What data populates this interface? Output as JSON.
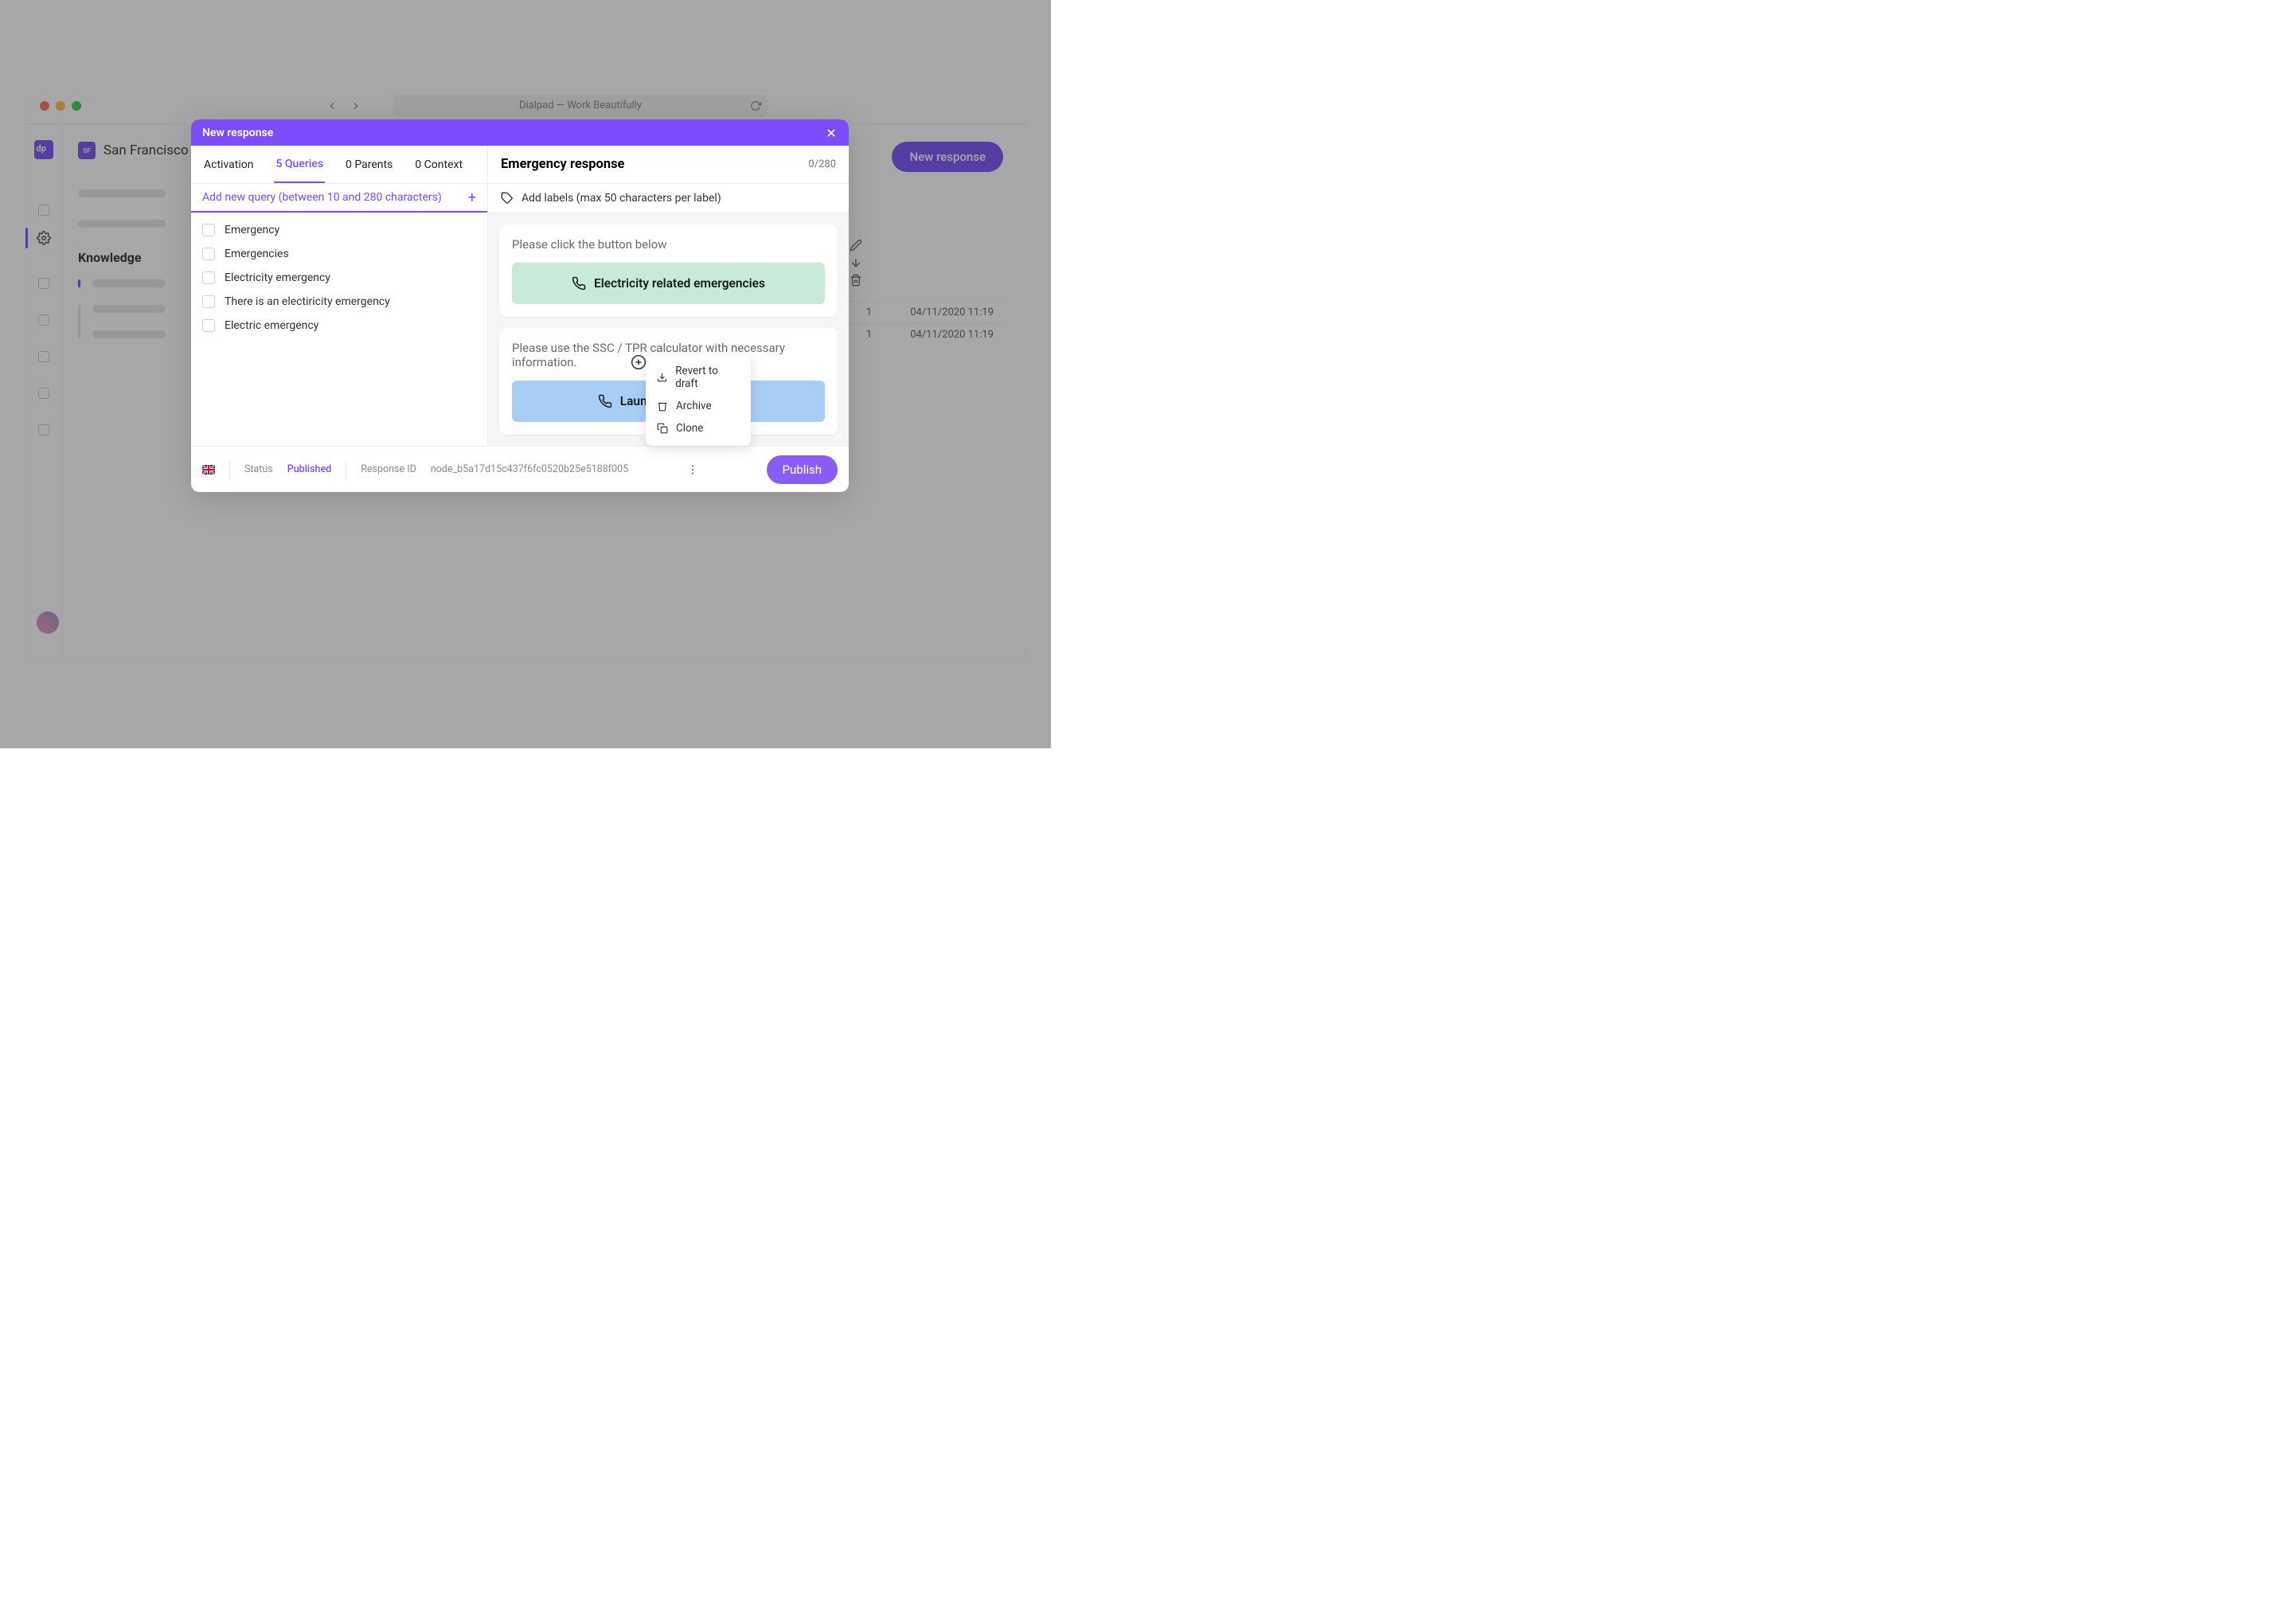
{
  "window": {
    "title": "Dialpad — Work Beautifully"
  },
  "sidebar": {
    "location_badge": "SF",
    "location": "San Francisco",
    "section_title": "Knowledge"
  },
  "header": {
    "new_response_button": "New response"
  },
  "table": {
    "rows": [
      {
        "count": "1",
        "date": "04/11/2020 11:19"
      },
      {
        "count": "1",
        "date": "04/11/2020 11:19"
      }
    ]
  },
  "modal": {
    "title": "New response",
    "tabs": {
      "activation": "Activation",
      "queries": "5 Queries",
      "parents": "0 Parents",
      "context": "0 Context"
    },
    "right_header": {
      "title": "Emergency response",
      "counter": "0/280"
    },
    "query_input_placeholder": "Add new query (between 10 and 280 characters)",
    "label_input_placeholder": "Add labels (max 50 characters per label)",
    "queries": [
      "Emergency",
      "Emergencies",
      "Electricity emergency",
      "There is an electiricity emergency",
      "Electric emergency"
    ],
    "cards": [
      {
        "text": "Please click the button below",
        "button_label": "Electricity related emergencies",
        "style": "green"
      },
      {
        "text": "Please use the SSC / TPR calculator with necessary information.",
        "button_label": "Launch the calculator",
        "style": "blue"
      }
    ],
    "context_menu": {
      "revert": "Revert to draft",
      "archive": "Archive",
      "clone": "Clone"
    },
    "footer": {
      "status_label": "Status",
      "status_value": "Published",
      "response_id_label": "Response ID",
      "response_id_value": "node_b5a17d15c437f6fc0520b25e5188f005",
      "publish_button": "Publish"
    }
  }
}
